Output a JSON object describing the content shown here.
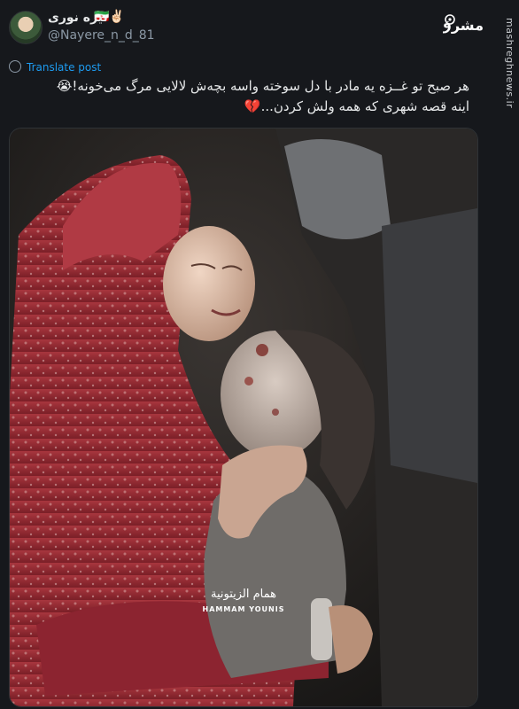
{
  "tweet": {
    "display_name": "نیره نوری",
    "name_emojis": "🇮🇷✌🏻",
    "handle": "@Nayere_n_d_81",
    "translate_label": "Translate post",
    "text_line1": "هر صبح تو غــزه یه مادر با دل سوخته واسه بچه‌ش لالایی مرگ می‌خونه!😭",
    "text_line2": "اینه قصه شهری که همه ولش کردن...💔"
  },
  "photo": {
    "credit_arabic": "همام الزيتونية",
    "credit_english": "HAMMAM YOUNIS"
  },
  "watermark": {
    "logo_text": "مشرق",
    "side_text": "mashreghnews.ir"
  }
}
